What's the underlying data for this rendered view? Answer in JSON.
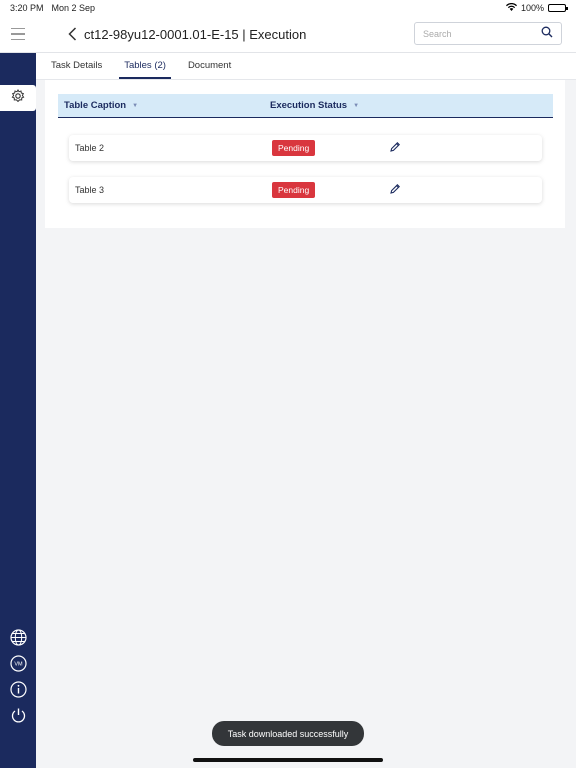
{
  "statusbar": {
    "time": "3:20 PM",
    "date": "Mon 2 Sep",
    "battery": "100%"
  },
  "header": {
    "title": "ct12-98yu12-0001.01-E-15 | Execution",
    "search_placeholder": "Search"
  },
  "tabs": [
    {
      "label": "Task Details",
      "active": false
    },
    {
      "label": "Tables (2)",
      "active": true
    },
    {
      "label": "Document",
      "active": false
    }
  ],
  "table": {
    "columns": [
      "Table Caption",
      "Execution Status"
    ],
    "rows": [
      {
        "caption": "Table 2",
        "status": "Pending"
      },
      {
        "caption": "Table 3",
        "status": "Pending"
      }
    ]
  },
  "sidebar": {
    "icons": [
      "gear-icon",
      "globe-icon",
      "vm-icon",
      "info-icon",
      "power-icon"
    ],
    "vm_label": "VM"
  },
  "toast": {
    "message": "Task downloaded successfully"
  },
  "colors": {
    "navy": "#1b2a5e",
    "status_red": "#d9363e",
    "header_bg": "#d6eaf8"
  }
}
